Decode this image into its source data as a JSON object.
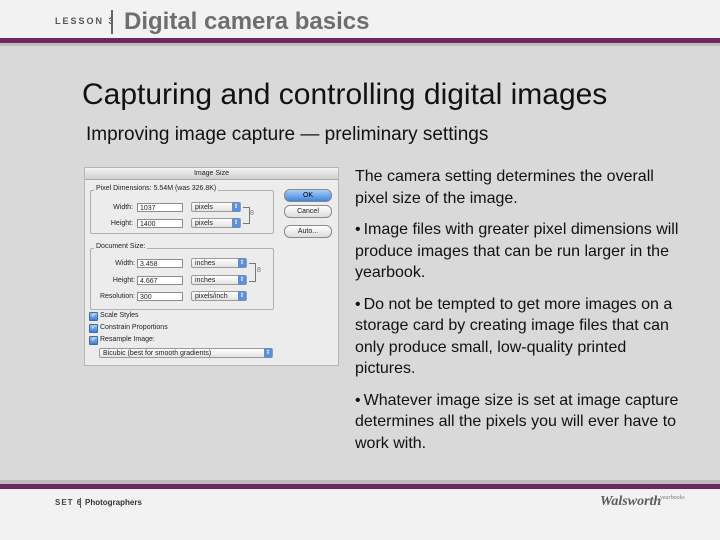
{
  "header": {
    "lesson": "LESSON 3",
    "title": "Digital camera basics"
  },
  "slide": {
    "title": "Capturing and controlling digital images",
    "subtitle": "Improving image capture — preliminary settings",
    "paragraphs": [
      "The camera setting determines the overall pixel size of the image.",
      "Image files with greater pixel dimensions will produce images that can be run larger in the yearbook.",
      "Do not be tempted to get more images on a storage card by creating image files that can only produce small, low-quality printed pictures.",
      "Whatever image size is set at image capture determines all the pixels you will ever have to work with."
    ]
  },
  "dialog": {
    "title": "Image Size",
    "pixel_dims_label": "Pixel Dimensions: 5.54M (was 326.8K)",
    "width_label": "Width:",
    "width_value": "1037",
    "width_unit": "pixels",
    "height_label": "Height:",
    "height_value": "1400",
    "height_unit": "pixels",
    "doc_size_label": "Document Size:",
    "doc_width_label": "Width:",
    "doc_width_value": "3.458",
    "doc_width_unit": "inches",
    "doc_height_label": "Height:",
    "doc_height_value": "4.667",
    "doc_height_unit": "inches",
    "resolution_label": "Resolution:",
    "resolution_value": "300",
    "resolution_unit": "pixels/inch",
    "scale_styles": "Scale Styles",
    "constrain": "Constrain Proportions",
    "resample": "Resample Image:",
    "resample_method": "Bicubic (best for smooth gradients)",
    "ok_label": "OK",
    "cancel_label": "Cancel",
    "auto_label": "Auto..."
  },
  "footer": {
    "set": "SET 6",
    "section": "Photographers",
    "logo": "Walsworth",
    "logo_sub": "yearbooks"
  },
  "colors": {
    "accent": "#6b2960",
    "background": "#d9d9d9"
  }
}
